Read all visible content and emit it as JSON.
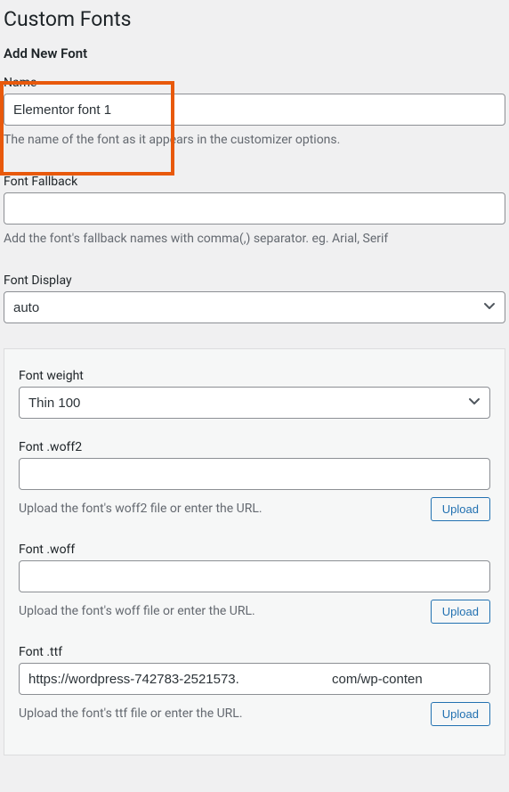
{
  "page": {
    "title": "Custom Fonts",
    "heading": "Add New Font"
  },
  "fields": {
    "name": {
      "label": "Name",
      "value": "Elementor font 1",
      "help": "The name of the font as it appears in the customizer options."
    },
    "fallback": {
      "label": "Font Fallback",
      "value": "",
      "help": "Add the font's fallback names with comma(,) separator. eg. Arial, Serif"
    },
    "display": {
      "label": "Font Display",
      "selected": "auto"
    }
  },
  "variation": {
    "weight": {
      "label": "Font weight",
      "selected": "Thin 100"
    },
    "woff2": {
      "label": "Font .woff2",
      "value": "",
      "help": "Upload the font's woff2 file or enter the URL.",
      "button": "Upload"
    },
    "woff": {
      "label": "Font .woff",
      "value": "",
      "help": "Upload the font's woff file or enter the URL.",
      "button": "Upload"
    },
    "ttf": {
      "label": "Font .ttf",
      "value": "https://wordpress-742783-2521573.                         com/wp-conten",
      "help": "Upload the font's ttf file or enter the URL.",
      "button": "Upload"
    }
  }
}
